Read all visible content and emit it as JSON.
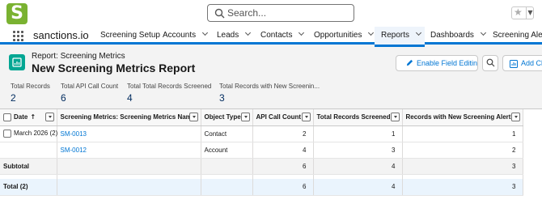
{
  "app": {
    "logo_letter": "S",
    "name": "sanctions.io"
  },
  "search": {
    "placeholder": "Search..."
  },
  "nav": {
    "items": [
      {
        "label": "Screening Setup"
      },
      {
        "label": "Accounts"
      },
      {
        "label": "Leads"
      },
      {
        "label": "Contacts"
      },
      {
        "label": "Opportunities"
      },
      {
        "label": "Reports"
      },
      {
        "label": "Dashboards"
      },
      {
        "label": "Screening Alerts"
      }
    ],
    "active": "Reports"
  },
  "page": {
    "subtitle": "Report: Screening Metrics",
    "title": "New Screening Metrics Report",
    "buttons": {
      "enable_field_editing": "Enable Field Editing",
      "add_chart": "Add Chart"
    }
  },
  "summary": [
    {
      "label": "Total Records",
      "value": "2"
    },
    {
      "label": "Total API Call Count",
      "value": "6"
    },
    {
      "label": "Total Total Records Screened",
      "value": "4"
    },
    {
      "label": "Total Records with New Screenin...",
      "value": "3"
    }
  ],
  "table": {
    "columns": [
      "Date",
      "Screening Metrics: Screening Metrics Name",
      "Object Type",
      "API Call Count",
      "Total Records Screened",
      "Records with New Screening Alerts"
    ],
    "group_label": "March 2026 (2)",
    "rows": [
      {
        "name": "SM-0013",
        "object_type": "Contact",
        "api_call_count": "2",
        "records_screened": "1",
        "new_alerts": "1"
      },
      {
        "name": "SM-0012",
        "object_type": "Account",
        "api_call_count": "4",
        "records_screened": "3",
        "new_alerts": "2"
      }
    ],
    "subtotal": {
      "label": "Subtotal",
      "api_call_count": "6",
      "records_screened": "4",
      "new_alerts": "3"
    },
    "total": {
      "label": "Total (2)",
      "api_call_count": "6",
      "records_screened": "4",
      "new_alerts": "3"
    }
  },
  "colors": {
    "brand_green": "#7ab231",
    "accent_blue": "#0176d3",
    "report_icon": "#03a693"
  }
}
